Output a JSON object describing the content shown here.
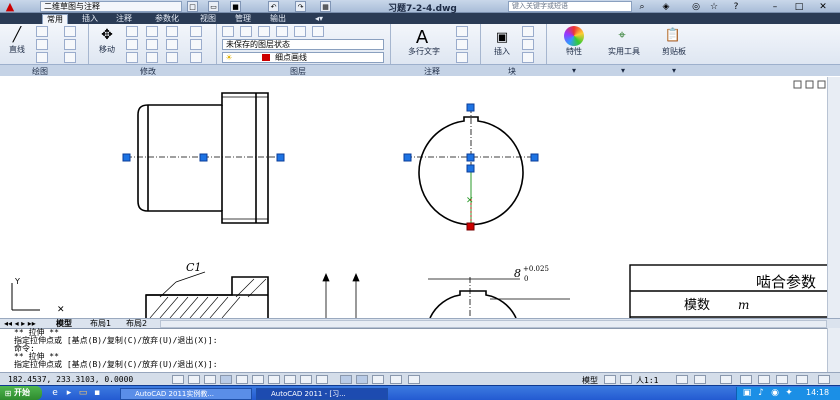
{
  "title_bar": {
    "workspace": "二维草图与注释",
    "file_name": "习题7-2-4.dwg",
    "search_placeholder": "键入关键字或短语"
  },
  "ribbon_tabs": [
    "常用",
    "插入",
    "注释",
    "参数化",
    "视图",
    "管理",
    "输出"
  ],
  "panels": {
    "draw": {
      "label": "绘图",
      "line_label": "直线"
    },
    "modify": {
      "label": "修改",
      "move_label": "移动"
    },
    "layers": {
      "label": "图层",
      "layer_state": "未保存的图层状态",
      "current_layer": "细点画线"
    },
    "annotation": {
      "label": "注释",
      "mtext_label": "多行文字"
    },
    "block": {
      "label": "块",
      "insert_label": "插入"
    },
    "properties": {
      "label": "特性"
    },
    "utilities": {
      "label": "实用工具"
    },
    "clipboard": {
      "label": "剪贴板"
    }
  },
  "drawing": {
    "chamfer_label": "C1",
    "tolerance_value": "8",
    "tolerance_upper": "+0.025",
    "tolerance_lower": "0",
    "table_title": "啮合参数",
    "table_row_label": "模数",
    "table_row_symbol": "m"
  },
  "layout_tabs": [
    "模型",
    "布局1",
    "布局2"
  ],
  "command_lines": [
    "** 拉伸 **",
    "指定拉伸点或 [基点(B)/复制(C)/放弃(U)/退出(X)]:",
    "命令:",
    "** 拉伸 **",
    "指定拉伸点或 [基点(B)/复制(C)/放弃(U)/退出(X)]:"
  ],
  "status": {
    "coordinates": "182.4537, 233.3103, 0.0000",
    "model_label": "模型",
    "scale": "人1:1"
  },
  "taskbar": {
    "start_label": "开始",
    "tasks": [
      "AutoCAD 2011实例教...",
      "AutoCAD 2011 - [习..."
    ],
    "clock": "14:18"
  }
}
